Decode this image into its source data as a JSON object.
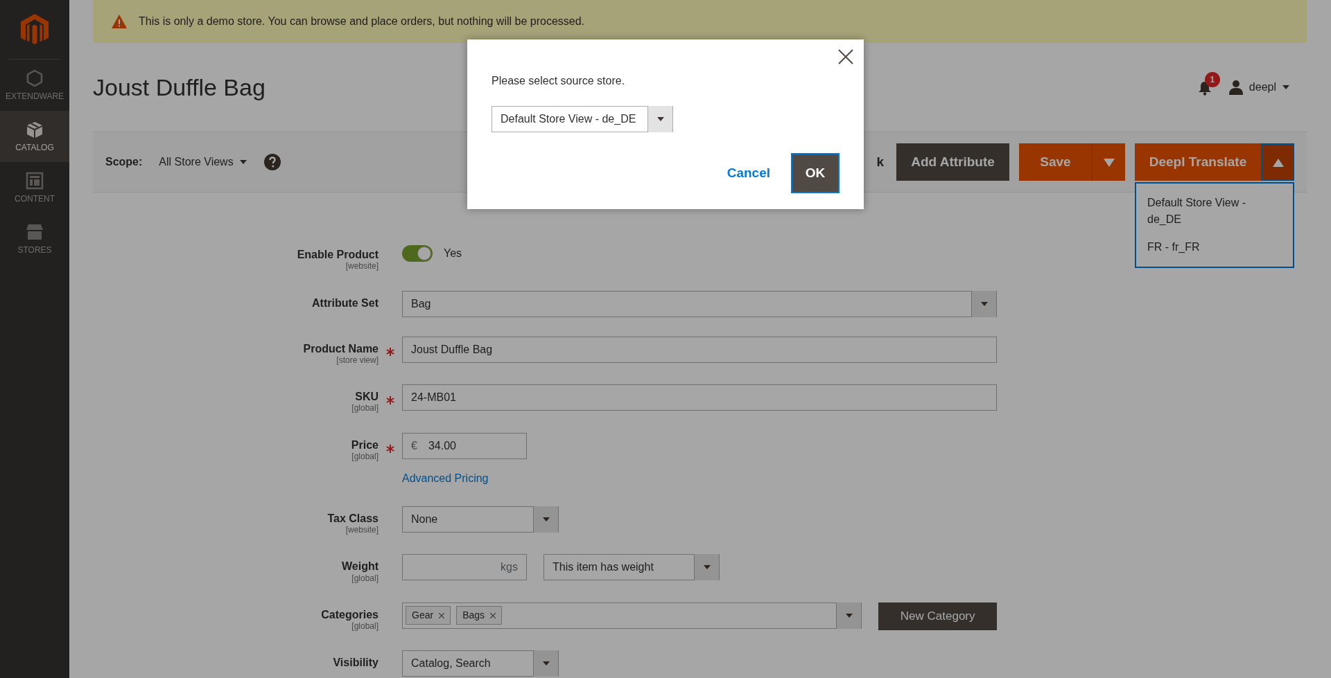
{
  "notice": {
    "text": "This is only a demo store. You can browse and place orders, but nothing will be processed."
  },
  "sidebar": {
    "items": [
      {
        "label": "EXTENDWARE",
        "selected": false
      },
      {
        "label": "CATALOG",
        "selected": true
      },
      {
        "label": "CONTENT",
        "selected": false
      },
      {
        "label": "STORES",
        "selected": false
      }
    ]
  },
  "header": {
    "title": "Joust Duffle Bag",
    "notifications": "1",
    "user": "deepl"
  },
  "toolbar": {
    "scope_label": "Scope:",
    "scope_value": "All Store Views",
    "buttons": [
      {
        "kind": "plain",
        "label": "k"
      },
      {
        "kind": "dark",
        "label": "Add Attribute"
      },
      {
        "kind": "split",
        "label": "Save",
        "expanded": false
      },
      {
        "kind": "split",
        "label": "Deepl Translate",
        "expanded": true
      }
    ]
  },
  "translate_menu": [
    "Default Store View - de_DE",
    "FR - fr_FR"
  ],
  "form": {
    "rows": [
      {
        "kind": "toggle",
        "label": "Enable Product",
        "scope": "[website]",
        "required": false,
        "on": true,
        "value": "Yes"
      },
      {
        "kind": "select",
        "label": "Attribute Set",
        "required": false,
        "value": "Bag"
      },
      {
        "kind": "text",
        "label": "Product Name",
        "scope": "[store view]",
        "required": true,
        "value": "Joust Duffle Bag"
      },
      {
        "kind": "text",
        "label": "SKU",
        "scope": "[global]",
        "required": true,
        "value": "24-MB01"
      },
      {
        "kind": "price",
        "label": "Price",
        "scope": "[global]",
        "required": true,
        "prefix": "€",
        "value": "34.00",
        "link": "Advanced Pricing"
      },
      {
        "kind": "short_select",
        "label": "Tax Class",
        "scope": "[website]",
        "required": false,
        "value": "None"
      },
      {
        "kind": "weight",
        "label": "Weight",
        "scope": "[global]",
        "required": false,
        "unit": "kgs",
        "select": "This item has weight"
      },
      {
        "kind": "tags",
        "label": "Categories",
        "scope": "[global]",
        "required": false,
        "tags": [
          "Gear",
          "Bags"
        ],
        "button": "New Category"
      },
      {
        "kind": "short_select",
        "label": "Visibility",
        "required": false,
        "value": "Catalog, Search"
      }
    ]
  },
  "modal": {
    "message": "Please select source store.",
    "select_value": "Default Store View - de_DE",
    "cancel": "Cancel",
    "ok": "OK"
  }
}
